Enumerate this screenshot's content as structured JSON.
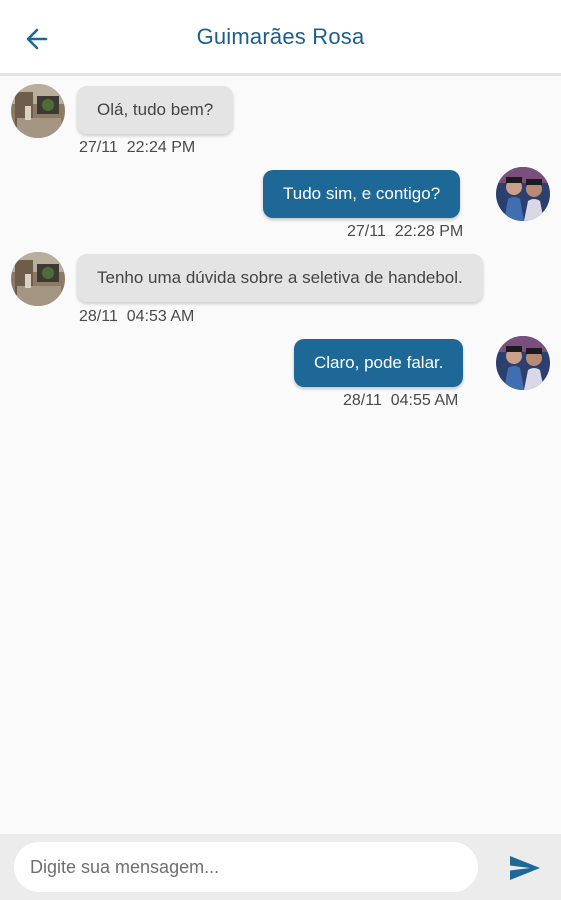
{
  "header": {
    "title": "Guimarães Rosa",
    "back_icon": "arrow-left-icon"
  },
  "messages": [
    {
      "direction": "in",
      "text": "Olá, tudo bem?",
      "time": "27/11  22:24 PM"
    },
    {
      "direction": "out",
      "text": "Tudo sim, e contigo?",
      "time": "27/11  22:28 PM"
    },
    {
      "direction": "in",
      "text": "Tenho uma dúvida sobre a seletiva de handebol.",
      "time": "28/11  04:53 AM"
    },
    {
      "direction": "out",
      "text": "Claro, pode falar.",
      "time": "28/11  04:55 AM"
    }
  ],
  "composer": {
    "placeholder": "Digite sua mensagem...",
    "value": "",
    "send_icon": "send-icon"
  },
  "colors": {
    "accent": "#1d6897",
    "title": "#1b5f8c",
    "incoming_bubble": "#e4e4e4",
    "background": "#fafafa"
  }
}
